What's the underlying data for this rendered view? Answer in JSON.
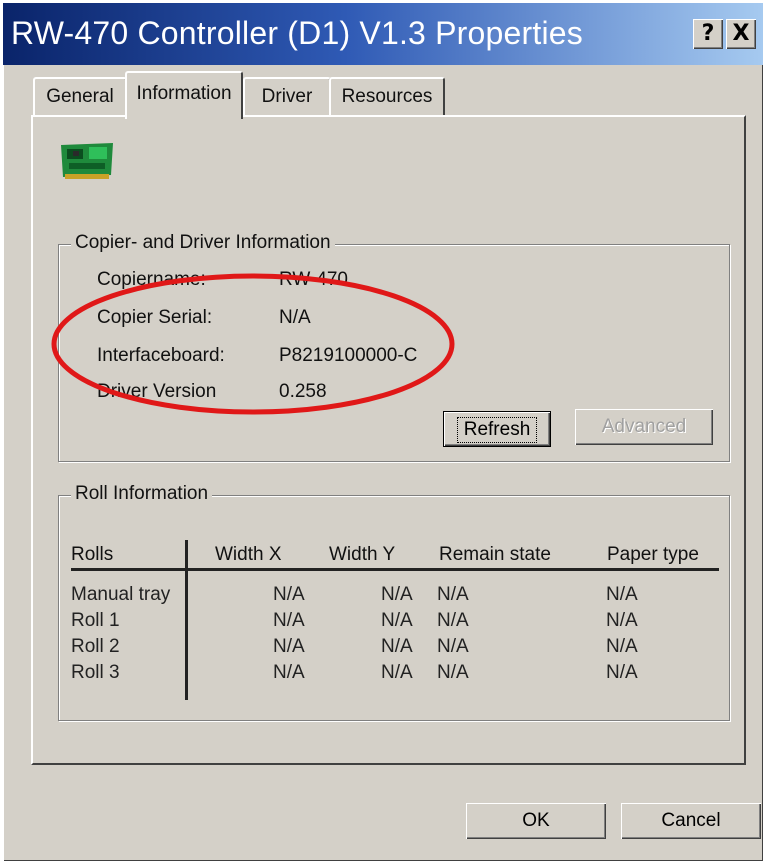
{
  "window": {
    "title": "RW-470 Controller (D1) V1.3 Properties",
    "help_label": "?",
    "close_label": "X"
  },
  "tabs": [
    {
      "label": "General"
    },
    {
      "label": "Information",
      "active": true
    },
    {
      "label": "Driver"
    },
    {
      "label": "Resources"
    }
  ],
  "icon": "network-card-icon",
  "copier_group": {
    "title": "Copier- and Driver Information",
    "rows": [
      {
        "label": "Copiername:",
        "value": "RW-470"
      },
      {
        "label": "Copier Serial:",
        "value": "N/A"
      },
      {
        "label": "Interfaceboard:",
        "value": "P8219100000-C"
      },
      {
        "label": "Driver Version",
        "value": "0.258"
      }
    ],
    "refresh_label": "Refresh",
    "advanced_label": "Advanced"
  },
  "roll_group": {
    "title": "Roll Information",
    "headers": [
      "Rolls",
      "Width X",
      "Width Y",
      "Remain state",
      "Paper type"
    ],
    "rows": [
      [
        "Manual tray",
        "N/A",
        "N/A",
        "N/A",
        "N/A"
      ],
      [
        "Roll 1",
        "N/A",
        "N/A",
        "N/A",
        "N/A"
      ],
      [
        "Roll 2",
        "N/A",
        "N/A",
        "N/A",
        "N/A"
      ],
      [
        "Roll 3",
        "N/A",
        "N/A",
        "N/A",
        "N/A"
      ]
    ]
  },
  "footer": {
    "ok_label": "OK",
    "cancel_label": "Cancel"
  },
  "colors": {
    "titlebar_start": "#0a246a",
    "titlebar_end": "#a6caf0",
    "dialog_face": "#d4d0c8",
    "annotation_ellipse": "#e01818"
  }
}
